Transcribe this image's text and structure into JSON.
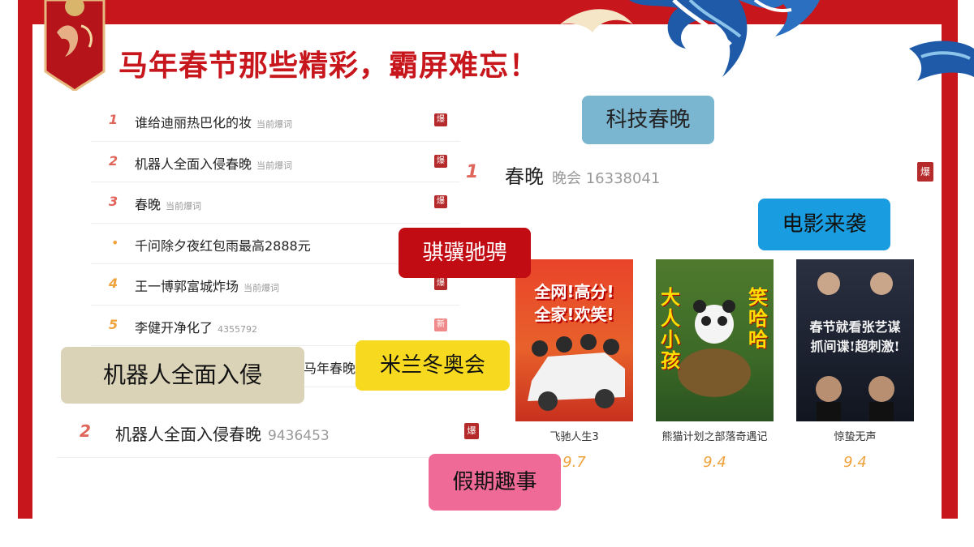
{
  "header": {
    "title": "马年春节那些精彩，霸屏难忘！"
  },
  "hot_list": [
    {
      "rank": "1",
      "text": "谁给迪丽热巴化的妆",
      "sub": "当前爆词",
      "tag": "爆"
    },
    {
      "rank": "2",
      "text": "机器人全面入侵春晚",
      "sub": "当前爆词",
      "tag": "爆"
    },
    {
      "rank": "3",
      "text": "春晚",
      "sub": "当前爆词",
      "tag": "爆"
    },
    {
      "rank": "•",
      "text": "千问除夕夜红包雨最高2888元",
      "sub": "",
      "tag": ""
    },
    {
      "rank": "4",
      "text": "王一博郭富城炸场",
      "sub": "当前爆词",
      "tag": "爆"
    },
    {
      "rank": "5",
      "text": "李健开净化了",
      "sub": "4355792",
      "tag": "新"
    }
  ],
  "partial_row_text": "马年春晚",
  "hot_overlay": {
    "rank": "2",
    "text": "机器人全面入侵春晚",
    "sub": "9436453",
    "tag": "爆"
  },
  "hot_featured": {
    "rank": "1",
    "text": "春晚",
    "sub": "晚会 16338041",
    "tag": "爆"
  },
  "labels": {
    "tech": "科技春晚",
    "movies": "电影来袭",
    "horses": "骐骥驰骋",
    "robots": "机器人全面入侵",
    "milan": "米兰冬奥会",
    "holiday": "假期趣事"
  },
  "colors": {
    "brand_red": "#c8161d",
    "score_gold": "#f0a23c"
  },
  "movies": [
    {
      "title": "飞驰人生3",
      "score": "9.7",
      "poster_text": [
        "全网!高分!",
        "全家!欢笑!"
      ]
    },
    {
      "title": "熊猫计划之部落奇遇记",
      "score": "9.4",
      "poster_text": [
        "大人小孩",
        "笑哈哈"
      ]
    },
    {
      "title": "惊蛰无声",
      "score": "9.4",
      "poster_text": [
        "春节就看张艺谋",
        "抓间谍!超刺激!"
      ]
    }
  ]
}
